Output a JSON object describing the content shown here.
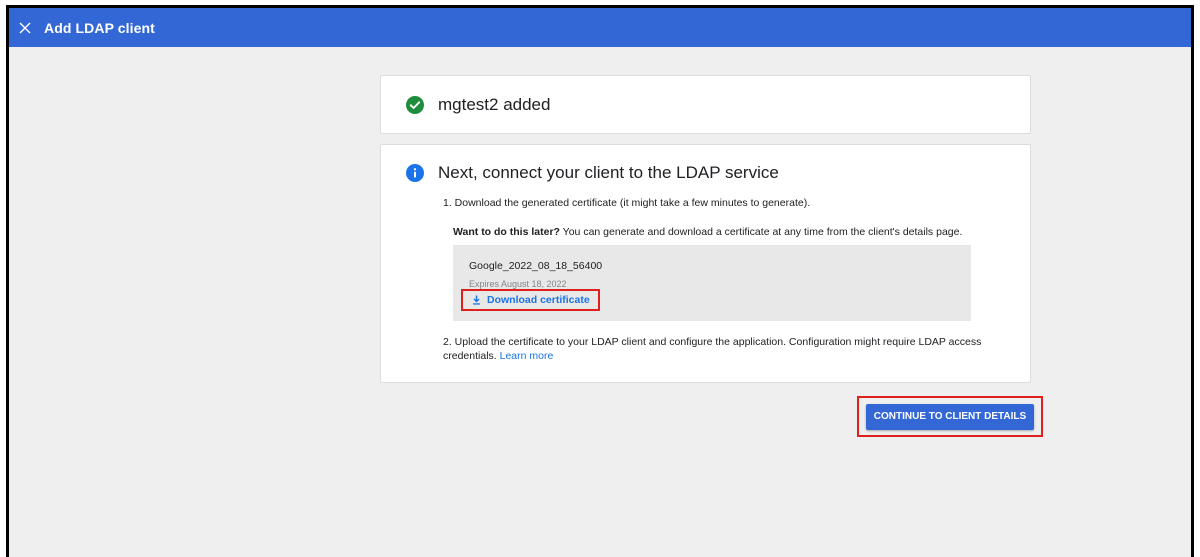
{
  "header": {
    "title": "Add LDAP client",
    "close_icon": "close-icon"
  },
  "status_card": {
    "icon": "check-circle-icon",
    "icon_color": "#1e8e3e",
    "message": "mgtest2 added"
  },
  "next_card": {
    "icon": "info-icon",
    "icon_color": "#1a73e8",
    "title": "Next, connect your client to the LDAP service",
    "step1": "1. Download the generated certificate (it might take a few minutes to generate).",
    "later_bold": "Want to do this later?",
    "later_text": " You can generate and download a certificate at any time from the client's details page.",
    "certificate": {
      "name": "Google_2022_08_18_56400",
      "expires": "Expires  August 18, 2022",
      "download_icon": "download-icon",
      "download_label": "Download certificate"
    },
    "step2": "2. Upload the certificate to your LDAP client and configure the application. Configuration might require LDAP access credentials.",
    "learn_more": "Learn more"
  },
  "actions": {
    "continue_label": "CONTINUE TO CLIENT DETAILS"
  },
  "colors": {
    "accent": "#3367d6",
    "link": "#1a73e8",
    "highlight": "#e0201c",
    "background": "#efefef"
  }
}
